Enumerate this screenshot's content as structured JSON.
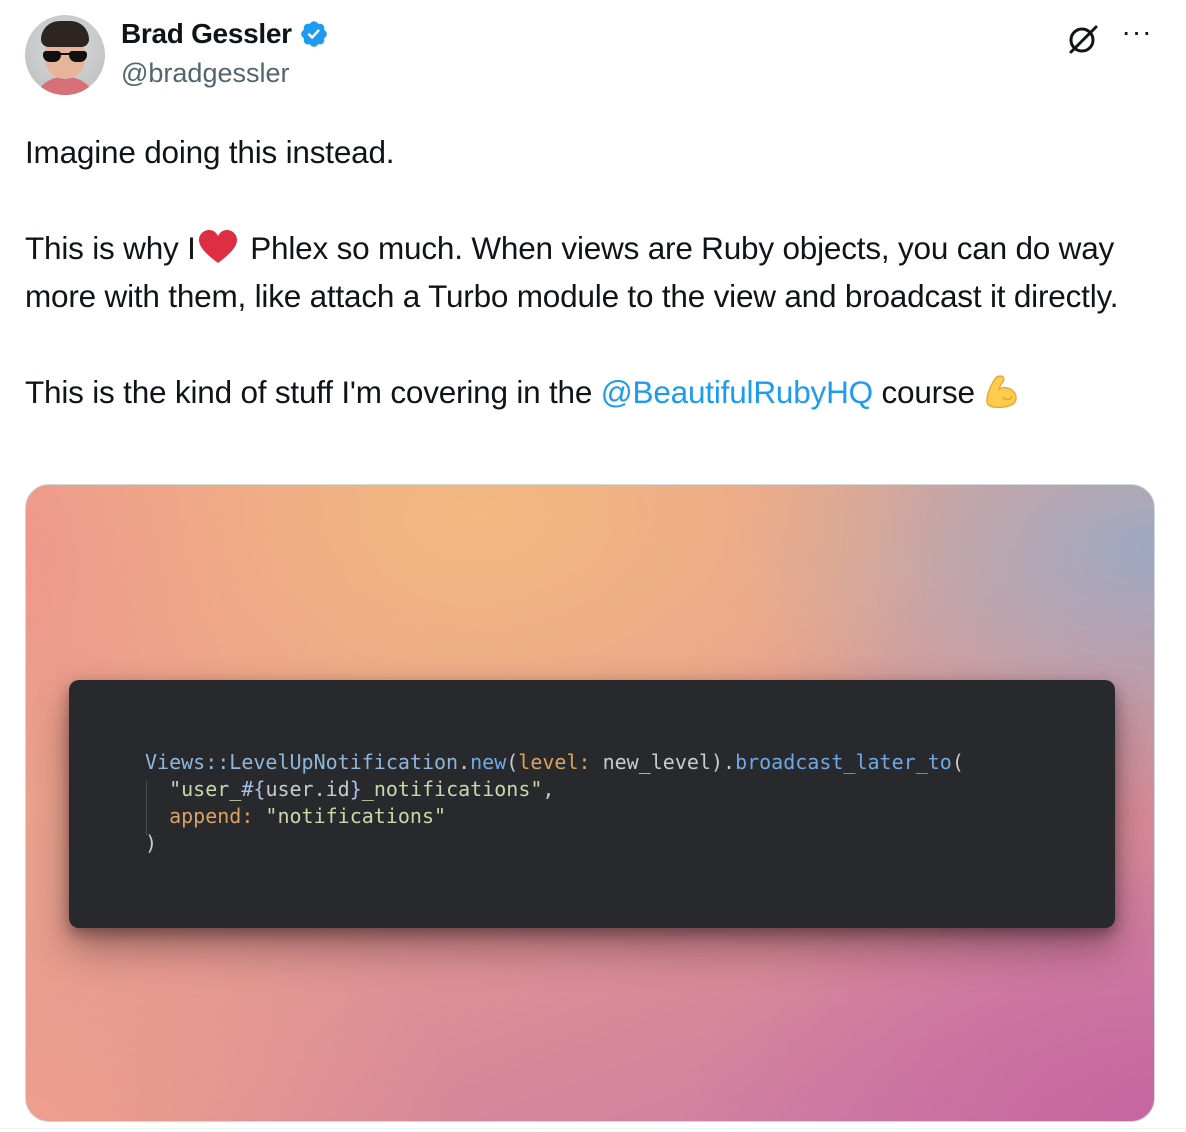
{
  "author": {
    "name": "Brad Gessler",
    "handle": "@bradgessler",
    "verified": true
  },
  "actions": {
    "grok_icon": "grok-icon",
    "more_label": "···"
  },
  "tweet": {
    "line1": "Imagine doing this instead.",
    "line2_prefix": "This is why I",
    "line2_suffix": "Phlex so much. When views are Ruby objects, you can do way more with them, like attach a Turbo module to the view and broadcast it directly.",
    "line3_prefix": "This is the kind of stuff I'm covering in the",
    "mention": "@BeautifulRubyHQ",
    "line3_suffix": "course",
    "emojis": [
      "red-heart",
      "flexed-biceps"
    ]
  },
  "code": {
    "l1_class": "Views::LevelUpNotification",
    "l1_dot": ".",
    "l1_new": "new",
    "l1_open": "(",
    "l1_key": "level:",
    "l1_val": " new_level",
    "l1_close": ").",
    "l1_method": "broadcast_later_to",
    "l1_paren": "(",
    "l2_q1": "\"user_",
    "l2_interp_open": "#{",
    "l2_interp_body": "user.id",
    "l2_interp_close": "}",
    "l2_q2": "_notifications\"",
    "l2_comma": ",",
    "l3_key": "append:",
    "l3_val": " \"notifications\"",
    "l4_close": ")"
  },
  "colors": {
    "mention": "#1d9bf0",
    "verified": "#1d9bf0",
    "code_bg": "#27292d"
  }
}
